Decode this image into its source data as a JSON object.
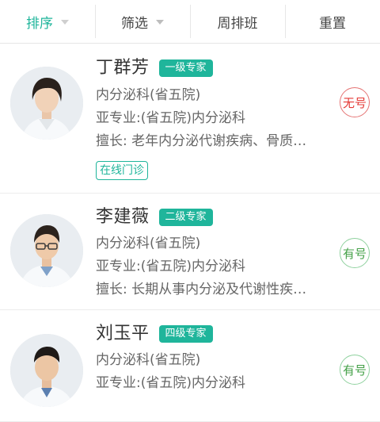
{
  "filter_bar": {
    "sort": "排序",
    "filter": "筛选",
    "weekly_schedule": "周排班",
    "reset": "重置"
  },
  "colors": {
    "accent": "#1fb59b",
    "no_number": "#e53935",
    "has_number": "#43a047"
  },
  "doctors": [
    {
      "name": "丁群芳",
      "title": "一级专家",
      "department": "内分泌科(省五院)",
      "subspecialty": "亚专业:(省五院)内分泌科",
      "expertise": "擅长:  老年内分泌代谢疾病、骨质…",
      "online_tag": "在线门诊",
      "status": "无号"
    },
    {
      "name": "李建薇",
      "title": "二级专家",
      "department": "内分泌科(省五院)",
      "subspecialty": "亚专业:(省五院)内分泌科",
      "expertise": "擅长:  长期从事内分泌及代谢性疾…",
      "status": "有号"
    },
    {
      "name": "刘玉平",
      "title": "四级专家",
      "department": "内分泌科(省五院)",
      "subspecialty": "亚专业:(省五院)内分泌科",
      "status": "有号"
    }
  ]
}
